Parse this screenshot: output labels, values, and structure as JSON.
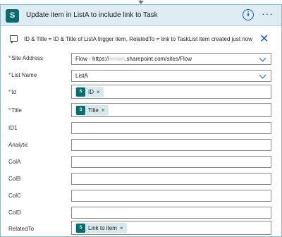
{
  "action": {
    "title": "Update item in ListA to include link to Task",
    "logo_letter": "S",
    "comment": "ID & Title = ID & Title of ListA trigger item, RelatedTo = link to TaskList item created just now"
  },
  "fields": {
    "site_address": {
      "label": "Site Address",
      "required": "*",
      "value_prefix": "Flow - https://",
      "value_blurred": "tenant",
      "value_suffix": ".sharepoint.com/sites/Flow"
    },
    "list_name": {
      "label": "List Name",
      "required": "*",
      "value": "ListA"
    },
    "id": {
      "label": "Id",
      "required": "*",
      "token": "ID",
      "token_remove": "×"
    },
    "title": {
      "label": "Title",
      "required": "*",
      "token": "Title",
      "token_remove": "×"
    },
    "id1": {
      "label": "ID1",
      "value": ""
    },
    "analytic": {
      "label": "Analytic",
      "value": ""
    },
    "cola": {
      "label": "ColA",
      "value": ""
    },
    "colb": {
      "label": "ColB",
      "value": ""
    },
    "colc": {
      "label": "ColC",
      "value": ""
    },
    "cold": {
      "label": "ColD",
      "value": ""
    },
    "related_to": {
      "label": "RelatedTo",
      "token": "Link to item",
      "token_remove": "×"
    }
  },
  "icons": {
    "info": "i",
    "more": "···",
    "close": "✕",
    "token_letter": "S"
  },
  "colors": {
    "header_bg": "#dcecf2",
    "accent": "#1a5fb4",
    "sharepoint": "#0b6a6b",
    "token_bg": "#d7e9ec",
    "required": "#c0392b"
  }
}
